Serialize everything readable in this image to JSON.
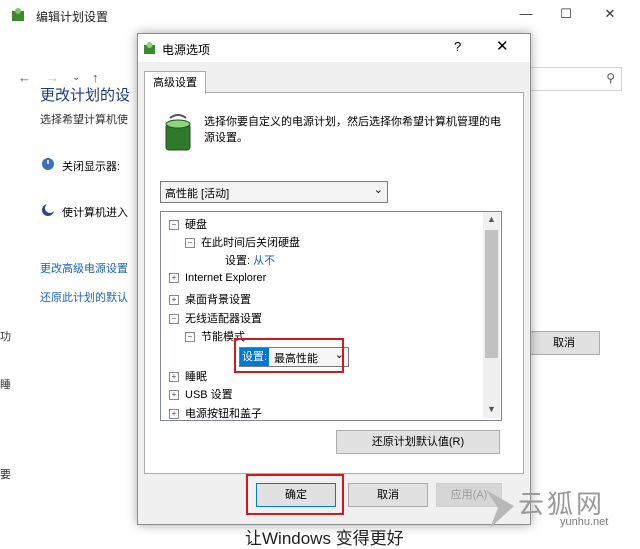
{
  "background_window": {
    "title": "编辑计划设置",
    "heading": "更改计划的设",
    "subtitle": "选择希望计算机使",
    "display_label": "关闭显示器:",
    "sleep_label": "使计算机进入",
    "advanced_link": "更改高级电源设置",
    "restore_link": "还原此计划的默认",
    "cancel_label": "取消",
    "bottom_text": "让Windows 变得更好",
    "edge_chars": [
      "功",
      "睡",
      "要"
    ]
  },
  "dialog": {
    "title": "电源选项",
    "help": "?",
    "close": "✕",
    "tab_label": "高级设置",
    "description": "选择你要自定义的电源计划，然后选择你希望计算机管理的电源设置。",
    "plan_select_value": "高性能 [活动]",
    "tree": {
      "hard_disk": "硬盘",
      "turn_off_hd_after": "在此时间后关闭硬盘",
      "setting_label": "设置:",
      "never": "从不",
      "internet_explorer": "Internet Explorer",
      "desktop_background": "桌面背景设置",
      "wireless_adapter": "无线适配器设置",
      "power_saving_mode": "节能模式",
      "setting_label2": "设置:",
      "max_performance": "最高性能",
      "sleep": "睡眠",
      "usb": "USB 设置",
      "power_buttons": "电源按钮和盖子"
    },
    "restore_defaults": "还原计划默认值(R)",
    "ok": "确定",
    "cancel": "取消",
    "apply": "应用(A)"
  },
  "watermark": {
    "text": "云狐网",
    "url": "yunhu.net"
  },
  "colors": {
    "link_blue": "#1a63c2",
    "highlight_red": "#d4181e",
    "selection_blue": "#0078d7"
  }
}
